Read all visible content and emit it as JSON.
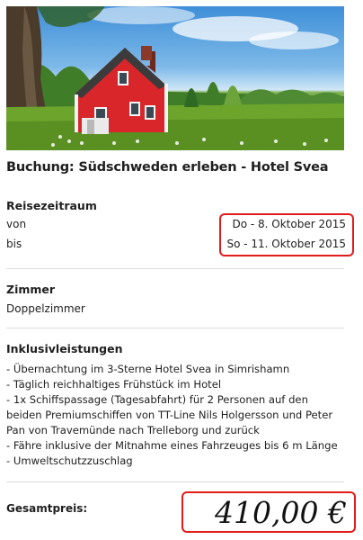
{
  "booking": {
    "title": "Buchung: Südschweden erleben - Hotel Svea",
    "travel_period": {
      "heading": "Reisezeitraum",
      "from_label": "von",
      "from_value": "Do - 8. Oktober 2015",
      "to_label": "bis",
      "to_value": "So - 11. Oktober 2015"
    },
    "room": {
      "heading": "Zimmer",
      "value": "Doppelzimmer"
    },
    "inclusions": {
      "heading": "Inklusivleistungen",
      "items": [
        "- Übernachtung im 3-Sterne Hotel Svea in Simrishamn",
        "- Täglich reichhaltiges Frühstück im Hotel",
        "- 1x Schiffspassage (Tagesabfahrt) für 2 Personen auf den",
        "beiden Premiumschiffen von TT-Line Nils Holgersson und Peter",
        "Pan von Travemünde nach Trelleborg und zurück",
        "- Fähre inklusive der Mitnahme eines Fahrzeuges bis 6 m Länge",
        "- Umweltschutzzuschlag"
      ]
    },
    "total": {
      "label": "Gesamtpreis:",
      "value": "410,00 €"
    }
  },
  "colors": {
    "highlight_border": "#e21b1b",
    "divider": "#dcdcdc"
  }
}
